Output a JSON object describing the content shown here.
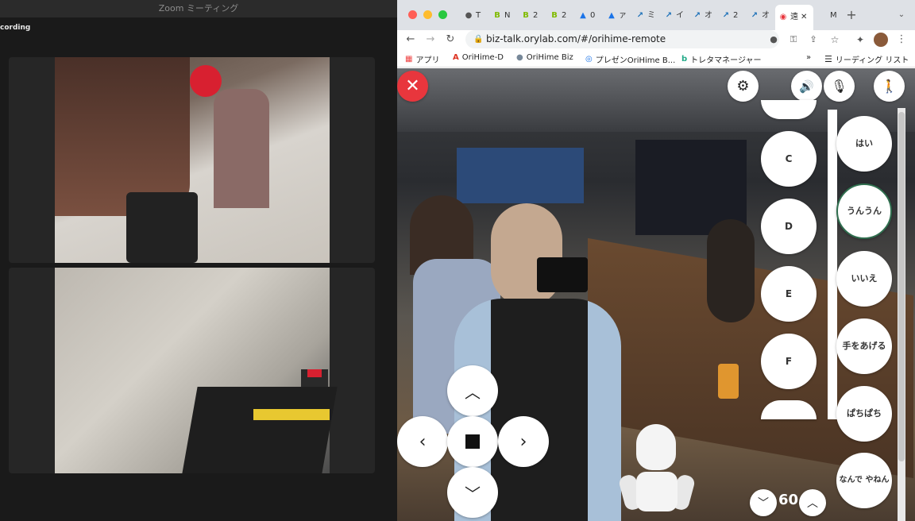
{
  "zoom": {
    "title": "Zoom ミーティング",
    "recording_label": "cording"
  },
  "browser": {
    "tabs": [
      {
        "label": "T",
        "icon": "globe-icon"
      },
      {
        "label": "N",
        "icon": "b-logo-icon"
      },
      {
        "label": "2",
        "icon": "b-logo-icon"
      },
      {
        "label": "2",
        "icon": "b-logo-icon"
      },
      {
        "label": "0",
        "icon": "drive-icon"
      },
      {
        "label": "ァ",
        "icon": "drive-icon"
      },
      {
        "label": "ミ",
        "icon": "arrow-logo-icon"
      },
      {
        "label": "イ",
        "icon": "arrow-logo-icon"
      },
      {
        "label": "オ",
        "icon": "arrow-logo-icon"
      },
      {
        "label": "2",
        "icon": "arrow-logo-icon"
      },
      {
        "label": "オ",
        "icon": "arrow-logo-icon"
      },
      {
        "label": "遠",
        "icon": "app-icon",
        "active": true
      },
      {
        "label": "M",
        "icon": "apple-icon"
      }
    ],
    "url": "biz-talk.orylab.com/#/orihime-remote",
    "bookmarks": [
      {
        "label": "アプリ",
        "icon": "apps-grid-icon"
      },
      {
        "label": "OriHime-D",
        "icon": "angular-icon"
      },
      {
        "label": "OriHime Biz",
        "icon": "orihime-icon"
      },
      {
        "label": "プレゼンOriHime B...",
        "icon": "chrome-icon"
      },
      {
        "label": "トレタマネージャー",
        "icon": "toreta-icon"
      }
    ],
    "reading_list_label": "リーディング リスト",
    "more_bookmarks": "»"
  },
  "remote": {
    "letters": [
      "C",
      "D",
      "E",
      "F"
    ],
    "presets": [
      "はい",
      "うんうん",
      "いいえ",
      "手をあげる",
      "ぱちぱち",
      "なんで やねん"
    ],
    "fps_value": "60"
  },
  "colors": {
    "close_red": "#e8363d",
    "accent_green": "#2f6e4e"
  }
}
